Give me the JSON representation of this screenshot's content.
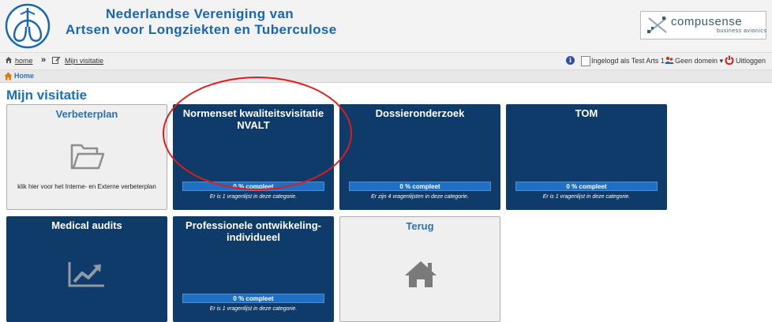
{
  "header": {
    "org_line1": "Nederlandse Vereniging van",
    "org_line2": "Artsen voor Longziekten en Tuberculose",
    "brand_name": "compusense",
    "brand_sub": "business avionics"
  },
  "breadcrumb": {
    "home": "home",
    "separator": "»",
    "current": "Mijn visitatie"
  },
  "userbar": {
    "user": "Ingelogd als Test Arts 1",
    "domain": "Geen domein",
    "logout": "Uitloggen"
  },
  "homebar": {
    "label": "Home"
  },
  "page": {
    "title": "Mijn visitatie"
  },
  "tiles": [
    {
      "title": "Verbeterplan",
      "description": "klik hier voor het Interne- en Externe verbeterplan",
      "icon": "folder-icon"
    },
    {
      "title": "Normenset kwaliteitsvisitatie NVALT",
      "progress_label": "0 % compleet",
      "progress": 0,
      "note": "Er is 1 vragenlijst in deze categorie."
    },
    {
      "title": "Dossieronderzoek",
      "progress_label": "0 % compleet",
      "progress": 0,
      "note": "Er zijn 4 vragenlijsten in deze categorie."
    },
    {
      "title": "TOM",
      "progress_label": "0 % compleet",
      "progress": 0,
      "note": "Er is 1 vragenlijst in deze categorie."
    },
    {
      "title": "Medical audits",
      "icon": "line-chart-icon"
    },
    {
      "title": "Professionele ontwikkeling-individueel",
      "progress_label": "0 % compleet",
      "progress": 0,
      "note": "Er is 1 vragenlijst in deze categorie."
    },
    {
      "title": "Terug",
      "icon": "house-icon"
    }
  ],
  "colors": {
    "tile_blue": "#0f3b6a",
    "progress_blue": "#1f70c4",
    "title_blue": "#1a6fc0",
    "annotation_red": "#e01b1b"
  }
}
